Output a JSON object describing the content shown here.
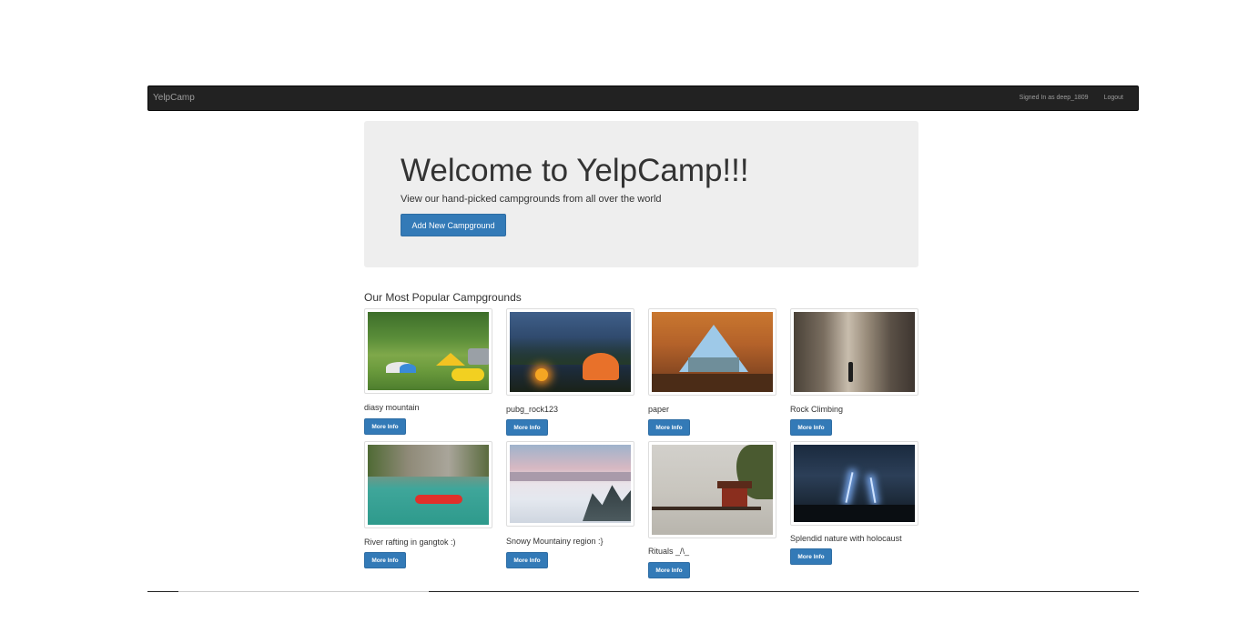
{
  "navbar": {
    "brand": "YelpCamp",
    "signed_in": "Signed In as deep_1809",
    "logout": "Logout"
  },
  "jumbotron": {
    "title": "Welcome to YelpCamp!!!",
    "subtitle": "View our hand-picked campgrounds from all over the world",
    "add_button": "Add New Campground"
  },
  "section_title": "Our Most Popular Campgrounds",
  "more_info_label": "More Info",
  "campgrounds": [
    {
      "name": "diasy mountain",
      "image": "campsite-forest-tents-photo"
    },
    {
      "name": "pubg_rock123",
      "image": "night-campfire-tent-photo"
    },
    {
      "name": "paper",
      "image": "tent-interior-view-photo"
    },
    {
      "name": "Rock Climbing",
      "image": "rock-canyon-photo"
    },
    {
      "name": "River rafting in gangtok :)",
      "image": "river-rafting-photo"
    },
    {
      "name": "Snowy Mountainy region :}",
      "image": "snowy-mountains-photo"
    },
    {
      "name": "Rituals _/\\_",
      "image": "lake-pagoda-photo"
    },
    {
      "name": "Splendid nature with holocaust",
      "image": "lightning-storm-photo"
    }
  ]
}
